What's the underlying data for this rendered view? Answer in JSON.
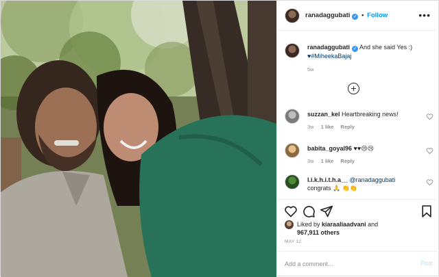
{
  "header": {
    "username": "ranadaggubati",
    "follow_label": "Follow",
    "separator": "•",
    "more_icon": "more-horizontal-icon"
  },
  "caption": {
    "username": "ranadaggubati",
    "text": "And she said Yes :)",
    "hashtag_line": "♥#MiheekaBajaj",
    "time": "5w"
  },
  "load_more_icon": "plus-circle-icon",
  "comments": [
    {
      "username": "suzzan_kel",
      "text": "Heartbreaking news!",
      "time": "3w",
      "likes": "1 like",
      "reply": "Reply"
    },
    {
      "username": "babita_goyal96",
      "text": "♥♥😢😢",
      "time": "3w",
      "likes": "1 like",
      "reply": "Reply"
    },
    {
      "username": "l.i.k.h.i.t.h.a__",
      "mention": "@ranadaggubati",
      "text": "congrats 🙏 👏👏"
    }
  ],
  "actions": {
    "like_icon": "heart-icon",
    "comment_icon": "comment-icon",
    "share_icon": "share-icon",
    "save_icon": "bookmark-icon"
  },
  "likes": {
    "prefix": "Liked by",
    "user": "kiaraaliaadvani",
    "conj": "and",
    "others": "967,911 others"
  },
  "date": "MAY 12",
  "add_comment": {
    "placeholder": "Add a comment...",
    "post_label": "Post"
  },
  "colors": {
    "accent": "#0095f6",
    "verified": "#3897f0",
    "post_disabled": "#b2dffc",
    "muted": "#8e8e8e"
  }
}
